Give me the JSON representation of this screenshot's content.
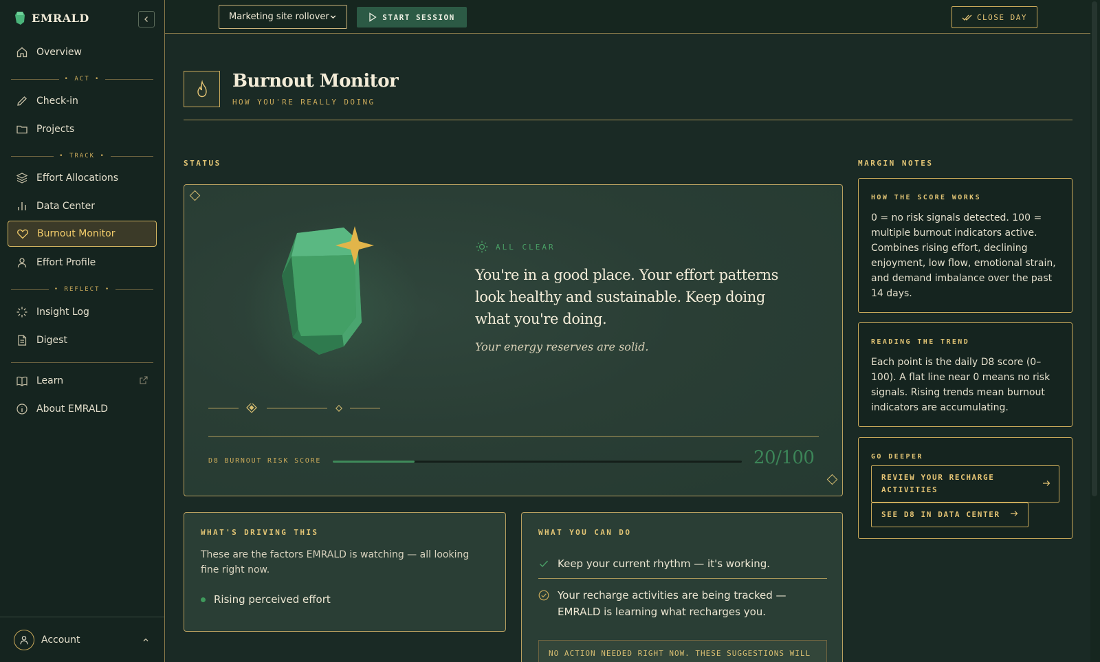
{
  "brand": {
    "name": "EMRALD"
  },
  "sidebar": {
    "overview": "Overview",
    "sections": {
      "act": "ACT",
      "track": "TRACK",
      "reflect": "REFLECT"
    },
    "items": {
      "checkin": "Check-in",
      "projects": "Projects",
      "effort_allocations": "Effort Allocations",
      "data_center": "Data Center",
      "burnout_monitor": "Burnout Monitor",
      "effort_profile": "Effort Profile",
      "insight_log": "Insight Log",
      "digest": "Digest",
      "learn": "Learn",
      "about": "About EMRALD"
    },
    "account": "Account"
  },
  "topbar": {
    "project": "Marketing site rollover",
    "start_session": "START SESSION",
    "close_day": "CLOSE DAY"
  },
  "page": {
    "title": "Burnout Monitor",
    "subtitle": "HOW YOU'RE REALLY DOING"
  },
  "status": {
    "section_label": "STATUS",
    "kicker": "ALL CLEAR",
    "headline": "You're in a good place. Your effort patterns look healthy and sustainable. Keep doing what you're doing.",
    "subline": "Your energy reserves are solid.",
    "score_label": "D8 BURNOUT RISK SCORE",
    "score": 20,
    "score_text": "20/100",
    "score_fraction": 0.2
  },
  "driving": {
    "kicker": "WHAT'S DRIVING THIS",
    "text": "These are the factors EMRALD is watching — all looking fine right now.",
    "items": [
      "Rising perceived effort"
    ]
  },
  "todo": {
    "kicker": "WHAT YOU CAN DO",
    "items": [
      "Keep your current rhythm — it's working.",
      "Your recharge activities are being tracked — EMRALD is learning what recharges you."
    ],
    "note": "NO ACTION NEEDED RIGHT NOW. THESE SUGGESTIONS WILL"
  },
  "margin": {
    "section_label": "MARGIN NOTES",
    "score_works": {
      "kicker": "HOW THE SCORE WORKS",
      "text": "0 = no risk signals detected. 100 = multiple burnout indicators active. Combines rising effort, declining enjoyment, low flow, emotional strain, and demand imbalance over the past 14 days."
    },
    "trend": {
      "kicker": "READING THE TREND",
      "text": "Each point is the daily D8 score (0–100). A flat line near 0 means no risk signals. Rising trends mean burnout indicators are accumulating."
    },
    "deeper": {
      "kicker": "GO DEEPER",
      "link1": "REVIEW YOUR RECHARGE ACTIVITIES",
      "link2": "SEE D8 IN DATA CENTER"
    }
  },
  "colors": {
    "background": "#1a2a25",
    "sidebar": "#15241f",
    "gold": "#d2b460",
    "emerald": "#3f8a5a"
  },
  "icons": [
    "home-icon",
    "pencil-icon",
    "folder-icon",
    "layers-icon",
    "bar-chart-icon",
    "heart-icon",
    "person-icon",
    "sparkle-icon",
    "document-icon",
    "book-icon",
    "info-icon",
    "external-link-icon",
    "flame-icon",
    "sun-icon",
    "check-icon",
    "check-circle-icon",
    "arrow-right-icon",
    "play-icon",
    "double-check-icon",
    "chevron-down-icon",
    "chevron-left-icon",
    "chevron-up-icon"
  ]
}
